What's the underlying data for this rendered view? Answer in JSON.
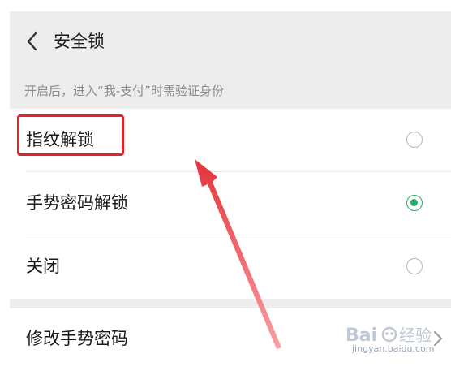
{
  "header": {
    "title": "安全锁",
    "back_icon": "chevron-left-icon"
  },
  "description": "开启后，进入“我-支付”时需验证身份",
  "options": [
    {
      "label": "指纹解锁",
      "selected": false
    },
    {
      "label": "手势密码解锁",
      "selected": true
    },
    {
      "label": "关闭",
      "selected": false
    }
  ],
  "modify": {
    "label": "修改手势密码",
    "chevron_icon": "chevron-right-icon"
  },
  "annotation": {
    "highlight_color": "#e0222b",
    "arrow_color": "#f05a5f"
  },
  "colors": {
    "accent_green": "#2aae67",
    "background_gray": "#ededed"
  },
  "watermark": {
    "text": "jingyan.baidu.com"
  }
}
